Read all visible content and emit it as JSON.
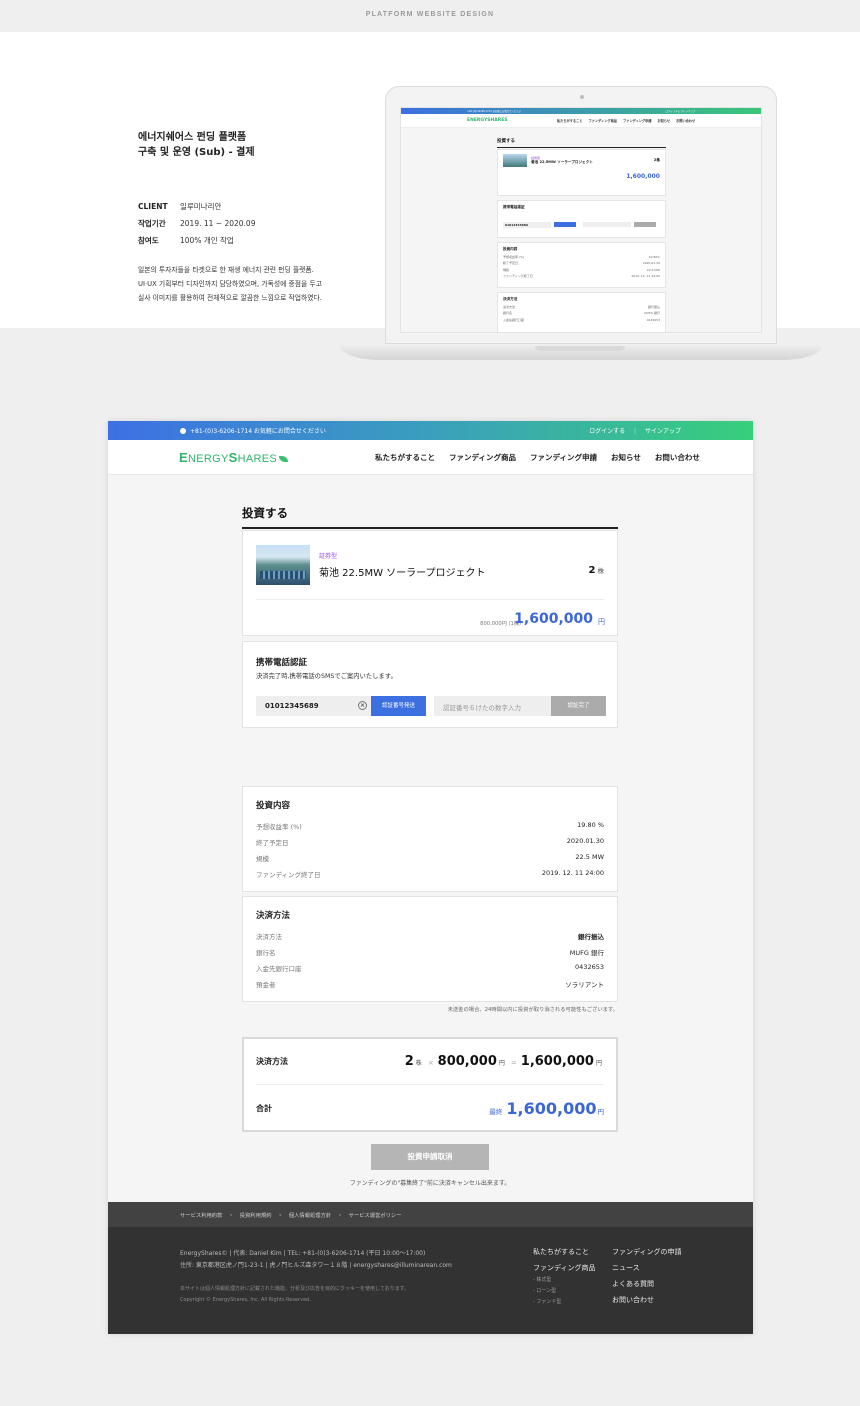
{
  "banner": {
    "label": "PLATFORM WEBSITE DESIGN"
  },
  "intro": {
    "title_line1": "에너지쉐어스 펀딩 플랫폼",
    "title_line2": "구축 및 운영 (Sub) - 결제",
    "meta": [
      {
        "key": "CLIENT",
        "value": "일루미나리안"
      },
      {
        "key": "작업기간",
        "value": "2019. 11 ~ 2020.09"
      },
      {
        "key": "참여도",
        "value": "100% 개인 작업"
      }
    ],
    "desc_line1": "일본의 투자자들을 타겟으로 한 재생 에너지 관련 펀딩 플랫폼.",
    "desc_line2": "UI·UX 기획부터 디자인까지 담당하였으며, 가독성에 중점을 두고",
    "desc_line3": "실사 이미지를 활용하여 전체적으로 깔끔한 느낌으로 작업하였다."
  },
  "site": {
    "topbar": {
      "contact": "+81-(0)3-6206-1714  お気軽にお問合せください",
      "login": "ログインする",
      "signup": "サインアップ"
    },
    "logo": {
      "part1": "E",
      "part2": "NERGY",
      "part3": "S",
      "part4": "HARES"
    },
    "menu": [
      "私たちがすること",
      "ファンディング商品",
      "ファンディング申請",
      "お知らせ",
      "お問い合わせ"
    ],
    "page_title": "投資する",
    "product": {
      "tag": "証券型",
      "name": "菊池 22.5MW ソーラープロジェクト",
      "qty": "2",
      "qty_unit": "株",
      "unit_price": "800,000円 (1株)",
      "total": "1,600,000",
      "yen": "円"
    },
    "auth": {
      "title": "携帯電話認証",
      "subtitle": "決済完了時,携帯電話のSMSでご案内いたします。",
      "phone_value": "01012345689",
      "send_label": "認証番号発送",
      "code_placeholder": "認証番号６けたの数字入力",
      "done_label": "認証完了"
    },
    "investment": {
      "title": "投資内容",
      "rows": [
        {
          "k": "予想収益率 (%)",
          "v": "19.80 %"
        },
        {
          "k": "終了予定日",
          "v": "2020.01.30"
        },
        {
          "k": "規模",
          "v": "22.5 MW"
        },
        {
          "k": "ファンディング終了日",
          "v": "2019. 12. 11 24:00"
        }
      ]
    },
    "payment": {
      "title": "決済方法",
      "rows": [
        {
          "k": "決済方法",
          "v": "銀行振込"
        },
        {
          "k": "銀行名",
          "v": "MUFG 銀行"
        },
        {
          "k": "入金先銀行口座",
          "v": "0432653"
        },
        {
          "k": "預金者",
          "v": "ソラリアント"
        }
      ]
    },
    "note": "未送金の場合、24時間以内に投資が取り消される可能性もございます。",
    "summary": {
      "method_label": "決済方法",
      "qty": "2",
      "qty_unit": "株",
      "times": "×",
      "price": "800,000",
      "price_unit": "円",
      "equals": "=",
      "subtotal": "1,600,000",
      "subtotal_unit": "円",
      "total_label": "合計",
      "final_label": "最終",
      "final_value": "1,600,000",
      "final_unit": "円"
    },
    "cancel_label": "投資申請取消",
    "cancel_note": "ファンディングの\"募集終了\"前に決済キャンセル出来ます。",
    "footer": {
      "links": [
        "サービス利用約款",
        "・",
        "投資利用規約",
        "・",
        "個人情報処理方針",
        "・",
        "サービス運営ポリシー"
      ],
      "line1": "EnergyShares©   |  代表: Daniel Kim   |  TEL: +81-(0)3-6206-1714 (平日 10:00～17:00)",
      "line2": "住所: 東京都港区虎ノ門1-23-1   |  虎ノ門ヒルズ森タワー１８階   |  energyshares@illuminarean.com",
      "small1": "本サイトは個人情報処理方針に記載された機能、分析及び広告を目的にクッキーを使用しております。",
      "small2": "Copyright © EnergyShares, Inc. All Rights Reserved.",
      "col1": [
        "私たちがすること",
        "ファンディング商品"
      ],
      "col1_sub": [
        "- 株式型",
        "- ローン型",
        "- ファンド型"
      ],
      "col2": [
        "ファンディングの申請",
        "ニュース",
        "よくある質問",
        "お問い合わせ"
      ]
    }
  },
  "mini": {
    "title": "投資する",
    "tag": "証券型",
    "name": "菊池 22.5MW ソーラープロジェクト",
    "qty": "2株",
    "total": "1,600,000",
    "auth_title": "携帯電話認証",
    "phone": "01012345689",
    "invest_title": "投資内容",
    "invest_rows": [
      {
        "k": "予想収益率 (%)",
        "v": "19.80%"
      },
      {
        "k": "終了予定日",
        "v": "2020.01.30"
      },
      {
        "k": "規模",
        "v": "22.5 MW"
      },
      {
        "k": "ファンディング終了日",
        "v": "2019. 12. 11 24:00"
      }
    ],
    "pay_title": "決済方法",
    "pay_rows": [
      {
        "k": "決済方法",
        "v": "銀行振込"
      },
      {
        "k": "銀行名",
        "v": "MUFG 銀行"
      },
      {
        "k": "入金先銀行口座",
        "v": "0432653"
      }
    ]
  },
  "colors": {
    "accent_blue": "#3a66d6",
    "brand_green": "#2fb36b",
    "tag_purple": "#9a4fd6"
  }
}
